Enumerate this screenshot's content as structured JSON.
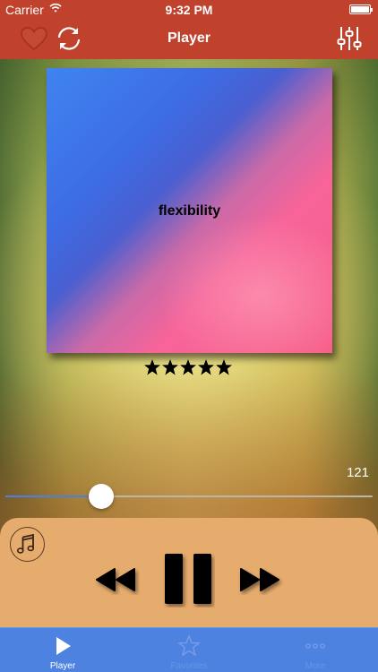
{
  "status_bar": {
    "carrier": "Carrier",
    "time": "9:32 PM"
  },
  "nav": {
    "title": "Player",
    "left_icons": [
      "heart-icon",
      "refresh-icon"
    ],
    "right_icon": "equalizer-icon",
    "bar_color": "#c0422c"
  },
  "album": {
    "title": "flexibility"
  },
  "rating": {
    "value": 5,
    "max": 5
  },
  "player": {
    "time_remaining": "121",
    "progress": 0.26,
    "accent_color": "#4a7fe4"
  },
  "controls": {
    "buttons": [
      "music-note-icon",
      "rewind-icon",
      "pause-icon",
      "fast-forward-icon"
    ]
  },
  "tab_bar": {
    "color": "#4d82e1",
    "tabs": [
      {
        "label": "Player",
        "icon": "play-icon",
        "active": true
      },
      {
        "label": "Favorites",
        "icon": "star-icon",
        "active": false
      },
      {
        "label": "More",
        "icon": "more-icon",
        "active": false
      }
    ]
  }
}
